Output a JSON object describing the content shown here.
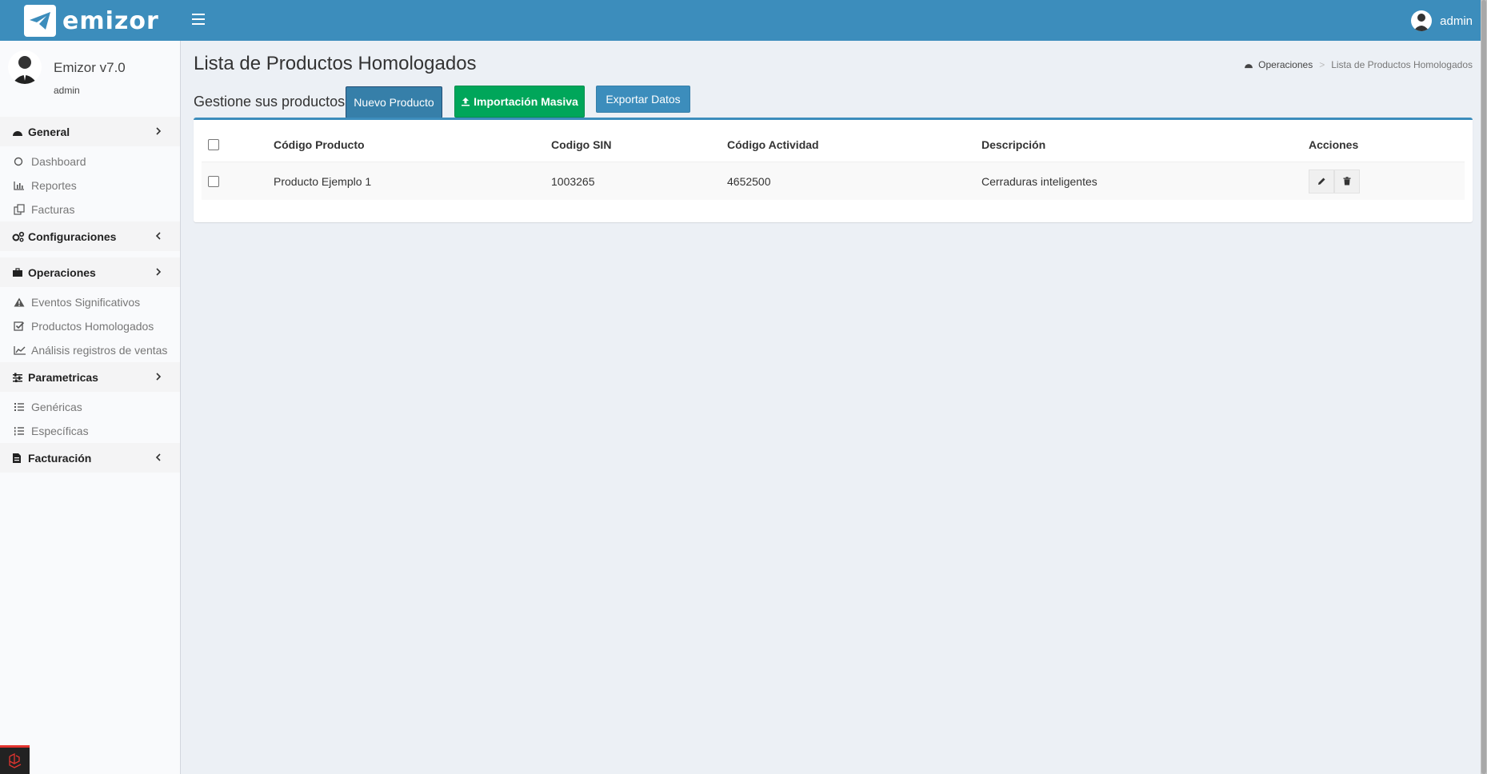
{
  "app": {
    "logo_text": "emizor",
    "user_name": "admin"
  },
  "sidebar": {
    "user_title": "Emizor v7.0",
    "user_role": "admin",
    "sections": [
      {
        "label": "General",
        "items": [
          "Dashboard",
          "Reportes",
          "Facturas"
        ]
      },
      {
        "label": "Configuraciones"
      },
      {
        "label": "Operaciones",
        "items": [
          "Eventos Significativos",
          "Productos Homologados",
          "Análisis registros de ventas"
        ]
      },
      {
        "label": "Parametricas",
        "items": [
          "Genéricas",
          "Específicas"
        ]
      },
      {
        "label": "Facturación"
      }
    ]
  },
  "page": {
    "title": "Lista de Productos Homologados",
    "subtitle": "Gestione sus productos",
    "breadcrumb": {
      "parent": "Operaciones",
      "current": "Lista de Productos Homologados"
    },
    "buttons": {
      "new": "Nuevo Producto",
      "import": "Importación Masiva",
      "export": "Exportar Datos"
    }
  },
  "table": {
    "headers": [
      "Código Producto",
      "Codigo SIN",
      "Código Actividad",
      "Descripción",
      "Acciones"
    ],
    "rows": [
      {
        "codigo_producto": "Producto Ejemplo 1",
        "codigo_sin": "1003265",
        "codigo_actividad": "4652500",
        "descripcion": "Cerraduras inteligentes"
      }
    ]
  },
  "colors": {
    "topbar": "#3c8dbc",
    "primary": "#367fa9",
    "success": "#00a65a",
    "info": "#3c8dbc",
    "background": "#ecf0f5"
  }
}
